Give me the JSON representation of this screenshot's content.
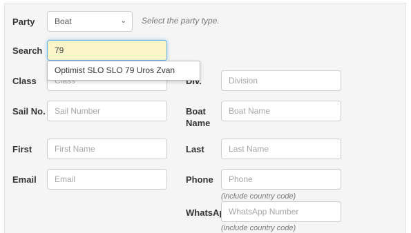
{
  "form": {
    "party": {
      "label": "Party",
      "value": "Boat",
      "help": "Select the party type."
    },
    "search": {
      "label": "Search",
      "value": "79"
    },
    "autocomplete": {
      "items": [
        "Optimist SLO SLO 79 Uros Zvan"
      ]
    },
    "class": {
      "label": "Class",
      "placeholder": "Class"
    },
    "division": {
      "label": "Div.",
      "placeholder": "Division"
    },
    "sail_no": {
      "label": "Sail No.",
      "placeholder": "Sail Number"
    },
    "boat_name": {
      "label_line1": "Boat",
      "label_line2": "Name",
      "placeholder": "Boat Name"
    },
    "first": {
      "label": "First",
      "placeholder": "First Name"
    },
    "last": {
      "label": "Last",
      "placeholder": "Last Name"
    },
    "email": {
      "label": "Email",
      "placeholder": "Email"
    },
    "phone": {
      "label": "Phone",
      "placeholder": "Phone",
      "help": "(include country code)"
    },
    "whatsapp": {
      "label": "WhatsApp",
      "placeholder": "WhatsApp Number",
      "help": "(include country code)"
    }
  }
}
